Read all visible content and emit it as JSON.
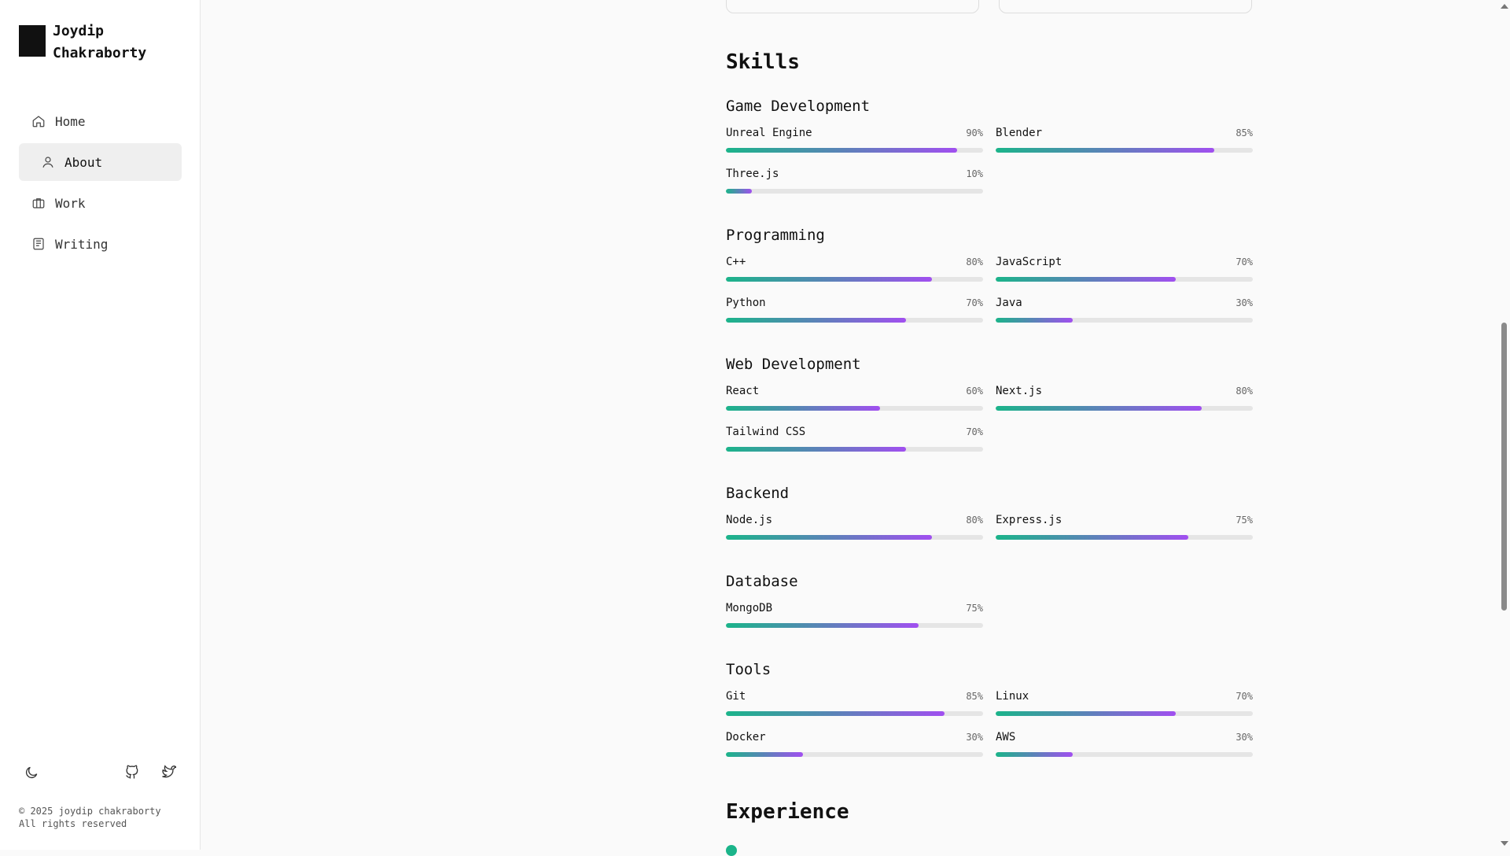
{
  "sidebar": {
    "name": "Joydip Chakraborty",
    "nav": [
      {
        "label": "Home",
        "icon": "home-icon"
      },
      {
        "label": "About",
        "icon": "user-icon"
      },
      {
        "label": "Work",
        "icon": "briefcase-icon"
      },
      {
        "label": "Writing",
        "icon": "newspaper-icon"
      }
    ],
    "active_nav": "About",
    "footer": {
      "copyright": "© 2025 joydip chakraborty",
      "rights": "All rights reserved"
    }
  },
  "skills": {
    "title": "Skills",
    "categories": [
      {
        "title": "Game Development",
        "items": [
          {
            "name": "Unreal Engine",
            "percent": "90%",
            "level": 0.9
          },
          {
            "name": "Blender",
            "percent": "85%",
            "level": 0.85
          },
          {
            "name": "Three.js",
            "percent": "10%",
            "level": 0.1
          }
        ]
      },
      {
        "title": "Programming",
        "items": [
          {
            "name": "C++",
            "percent": "80%",
            "level": 0.8
          },
          {
            "name": "JavaScript",
            "percent": "70%",
            "level": 0.7
          },
          {
            "name": "Python",
            "percent": "70%",
            "level": 0.7
          },
          {
            "name": "Java",
            "percent": "30%",
            "level": 0.3
          }
        ]
      },
      {
        "title": "Web Development",
        "items": [
          {
            "name": "React",
            "percent": "60%",
            "level": 0.6
          },
          {
            "name": "Next.js",
            "percent": "80%",
            "level": 0.8
          },
          {
            "name": "Tailwind CSS",
            "percent": "70%",
            "level": 0.7
          }
        ]
      },
      {
        "title": "Backend",
        "items": [
          {
            "name": "Node.js",
            "percent": "80%",
            "level": 0.8
          },
          {
            "name": "Express.js",
            "percent": "75%",
            "level": 0.75
          }
        ]
      },
      {
        "title": "Database",
        "items": [
          {
            "name": "MongoDB",
            "percent": "75%",
            "level": 0.75
          }
        ]
      },
      {
        "title": "Tools",
        "items": [
          {
            "name": "Git",
            "percent": "85%",
            "level": 0.85
          },
          {
            "name": "Linux",
            "percent": "70%",
            "level": 0.7
          },
          {
            "name": "Docker",
            "percent": "30%",
            "level": 0.3
          },
          {
            "name": "AWS",
            "percent": "30%",
            "level": 0.3
          }
        ]
      }
    ]
  },
  "experience": {
    "title": "Experience"
  },
  "colors": {
    "gradient_start": "#1bb48a",
    "gradient_end": "#a14ff0",
    "track": "#e5e5e5",
    "accent_dot": "#1bb48a"
  }
}
